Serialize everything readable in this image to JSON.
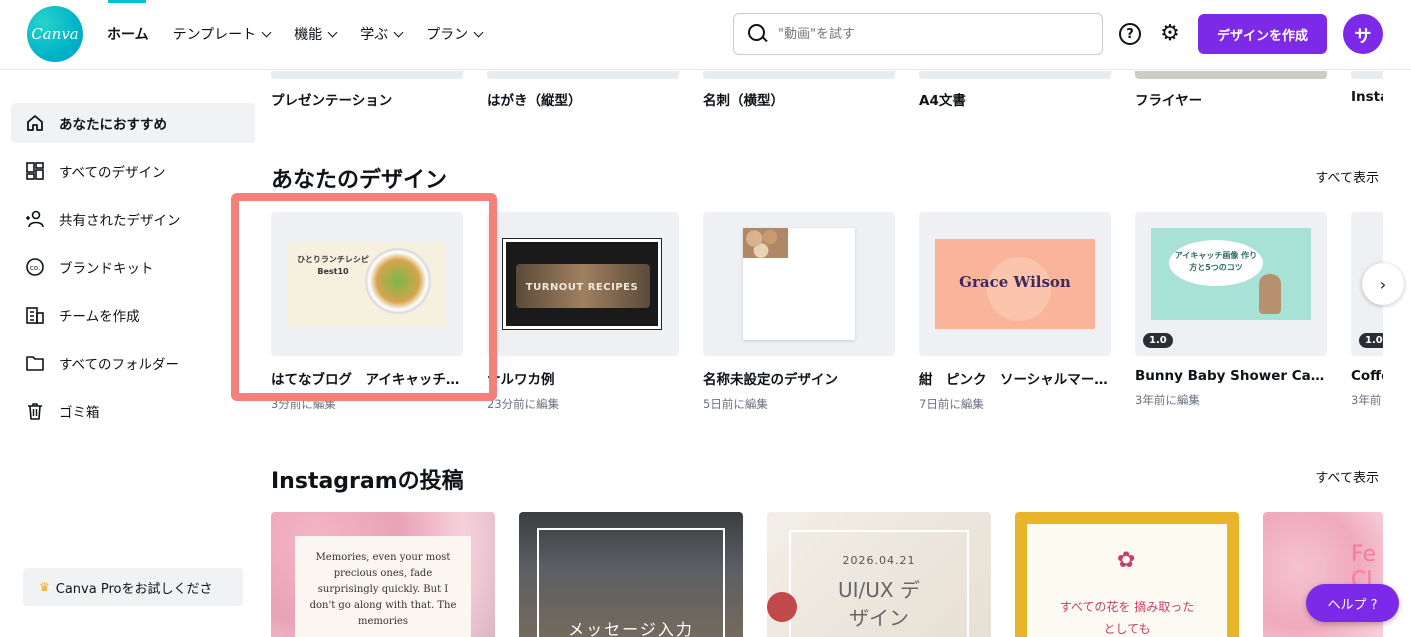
{
  "header": {
    "logo_text": "Canva",
    "nav": [
      {
        "label": "ホーム",
        "dropdown": false
      },
      {
        "label": "テンプレート",
        "dropdown": true
      },
      {
        "label": "機能",
        "dropdown": true
      },
      {
        "label": "学ぶ",
        "dropdown": true
      },
      {
        "label": "プラン",
        "dropdown": true
      }
    ],
    "search_placeholder": "\"動画\"を試す",
    "help_icon": "?",
    "create_label": "デザインを作成",
    "avatar_initial": "サ"
  },
  "sidebar": {
    "items": [
      {
        "label": "あなたにおすすめ",
        "icon": "home-icon",
        "active": true
      },
      {
        "label": "すべてのデザイン",
        "icon": "grid-icon",
        "active": false
      },
      {
        "label": "共有されたデザイン",
        "icon": "users-icon",
        "active": false
      },
      {
        "label": "ブランドキット",
        "icon": "brand-icon",
        "active": false
      },
      {
        "label": "チームを作成",
        "icon": "building-icon",
        "active": false
      },
      {
        "label": "すべてのフォルダー",
        "icon": "folder-icon",
        "active": false
      },
      {
        "label": "ゴミ箱",
        "icon": "trash-icon",
        "active": false
      }
    ],
    "pro_label": "Canva Proをお試しくださ"
  },
  "templates": {
    "labels": [
      "プレゼンテーション",
      "はがき（縦型）",
      "名刺（横型）",
      "A4文書",
      "フライヤー",
      "Insta"
    ]
  },
  "your_designs": {
    "title": "あなたのデザイン",
    "see_all": "すべて表示",
    "cards": [
      {
        "title": "はてなブログ　アイキャッチ…",
        "sub": "3分前に編集",
        "thumb_text": "ひとりランチレシピ Best10"
      },
      {
        "title": "ナルワカ例",
        "sub": "23分前に編集",
        "thumb_text": "TURNOUT RECIPES"
      },
      {
        "title": "名称未設定のデザイン",
        "sub": "5日前に編集",
        "thumb_text": ""
      },
      {
        "title": "紺　ピンク　ソーシャルマー…",
        "sub": "7日前に編集",
        "thumb_text": "Grace Wilson"
      },
      {
        "title": "Bunny Baby Shower Card",
        "sub": "3年前に編集",
        "badge": "1.0",
        "thumb_text": "アイキャッチ画像 作り方と5つのコツ"
      },
      {
        "title": "Coffe",
        "sub": "3年前",
        "badge": "1.0",
        "thumb_text": ""
      }
    ]
  },
  "instagram": {
    "title": "Instagramの投稿",
    "see_all": "すべて表示",
    "cards": [
      {
        "text": "Memories, even your most precious ones, fade surprisingly quickly. But I don't go along with that. The memories"
      },
      {
        "text": "メッセージ入力"
      },
      {
        "date": "2026.04.21",
        "text": "UI/UX デザイン"
      },
      {
        "text": "すべての花を 摘み取ったとしても"
      },
      {
        "text": "Fe Cl"
      }
    ]
  },
  "help_label": "ヘルプ ?",
  "colors": {
    "brand": "#7d2ae8",
    "accent": "#00c4cc",
    "highlight": "#f4807a"
  }
}
